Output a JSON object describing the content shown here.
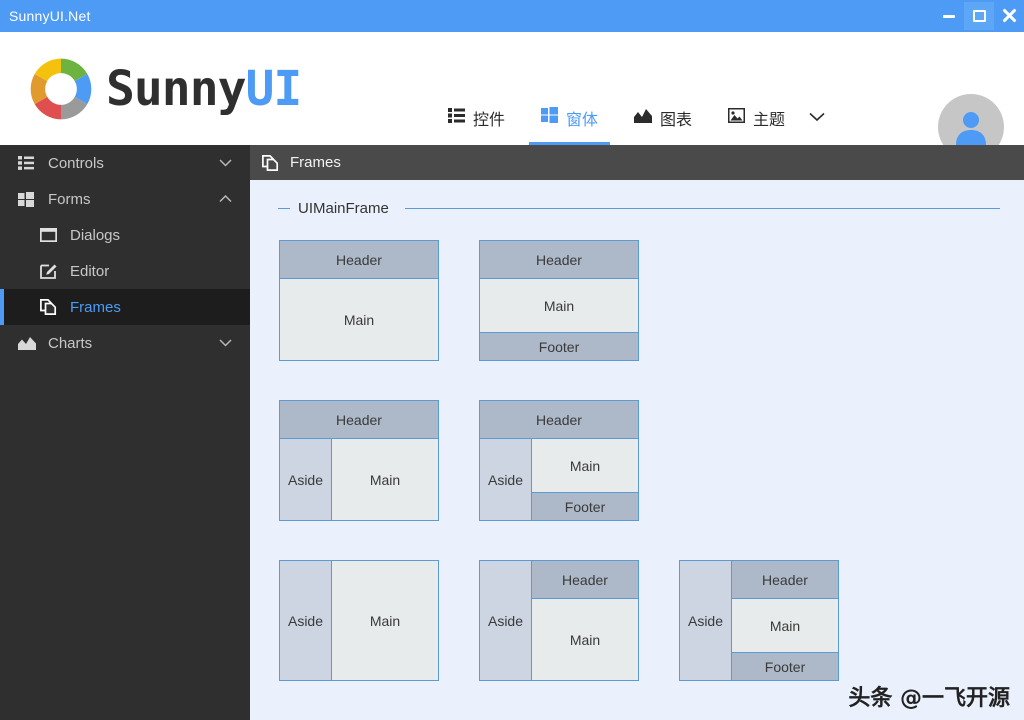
{
  "window": {
    "title": "SunnyUI.Net",
    "controls": [
      {
        "name": "minimize",
        "label": "Minimize"
      },
      {
        "name": "maximize",
        "label": "Maximize"
      },
      {
        "name": "close",
        "label": "Close"
      }
    ]
  },
  "brand": {
    "sunny": "Sunny",
    "ui": "UI"
  },
  "nav": {
    "tabs": [
      {
        "label": "控件",
        "icon": "list-icon",
        "active": false
      },
      {
        "label": "窗体",
        "icon": "windows-icon",
        "active": true
      },
      {
        "label": "图表",
        "icon": "chart-icon",
        "active": false
      },
      {
        "label": "主题",
        "icon": "image-icon",
        "active": false
      }
    ],
    "more_icon": "chevron-down-icon"
  },
  "sidebar": {
    "items": [
      {
        "label": "Controls",
        "icon": "list-icon",
        "level": 1,
        "chevron": "down",
        "selected": false
      },
      {
        "label": "Forms",
        "icon": "windows-icon",
        "level": 1,
        "chevron": "up",
        "selected": false
      },
      {
        "label": "Dialogs",
        "icon": "window-icon",
        "level": 2,
        "chevron": "",
        "selected": false
      },
      {
        "label": "Editor",
        "icon": "edit-icon",
        "level": 2,
        "chevron": "",
        "selected": false
      },
      {
        "label": "Frames",
        "icon": "copy-icon",
        "level": 2,
        "chevron": "",
        "selected": true
      },
      {
        "label": "Charts",
        "icon": "chart-icon",
        "level": 1,
        "chevron": "down",
        "selected": false
      }
    ]
  },
  "content": {
    "header": {
      "title": "Frames",
      "icon": "copy-icon"
    },
    "group_title": "UIMainFrame",
    "zone_labels": {
      "header": "Header",
      "main": "Main",
      "footer": "Footer",
      "aside": "Aside"
    },
    "cards": [
      {
        "name": "header-main",
        "zones": [
          "Header",
          "Main"
        ]
      },
      {
        "name": "header-main-footer",
        "zones": [
          "Header",
          "Main",
          "Footer"
        ]
      },
      {
        "name": "header-aside-main",
        "zones": [
          "Header",
          "Aside",
          "Main"
        ]
      },
      {
        "name": "header-aside-main-footer",
        "zones": [
          "Header",
          "Aside",
          "Main",
          "Footer"
        ]
      },
      {
        "name": "aside-main",
        "zones": [
          "Aside",
          "Main"
        ]
      },
      {
        "name": "aside-header-main",
        "zones": [
          "Aside",
          "Header",
          "Main"
        ]
      },
      {
        "name": "aside-header-main-footer",
        "zones": [
          "Aside",
          "Header",
          "Main",
          "Footer"
        ]
      }
    ]
  },
  "watermark": "头条 @一飞开源",
  "colors": {
    "title_bar": "#4d9bf5",
    "accent": "#4d9bf5",
    "sidebar_bg": "#2f2f2f",
    "sidebar_selected_bg": "#1d1d1d",
    "content_bg": "#eaf1fd",
    "content_head_bg": "#4a4a4a",
    "zone_border": "#5b9bd5",
    "zone_header": "#adb9c8",
    "zone_main": "#e8ebec",
    "zone_aside": "#ccd5e1"
  }
}
